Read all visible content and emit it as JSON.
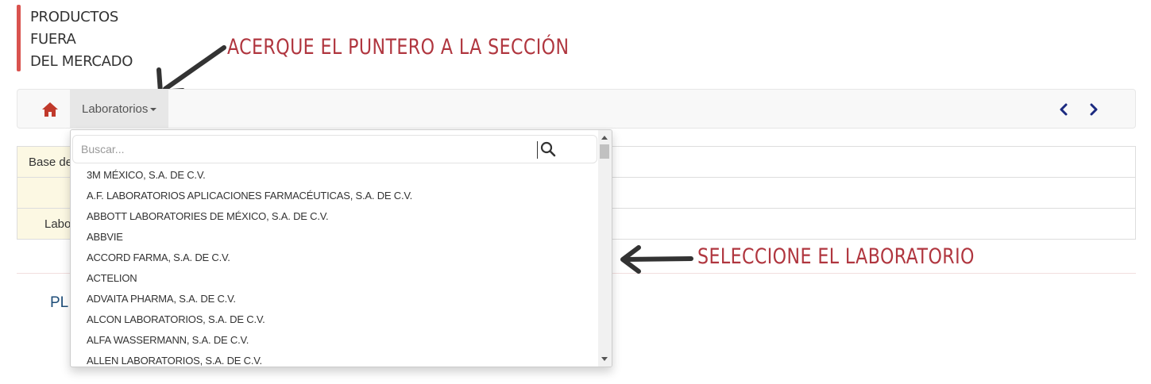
{
  "header": {
    "title_lines": [
      "PRODUCTOS",
      "FUERA",
      "DEL MERCADO"
    ]
  },
  "annotations": {
    "hover_hint": "ACERQUE EL PUNTERO A LA SECCIÓN",
    "select_hint": "SELECCIONE EL LABORATORIO"
  },
  "navbar": {
    "home_icon": "home-icon",
    "menu_label": "Laboratorios",
    "prev_icon": "chevron-left-icon",
    "next_icon": "chevron-right-icon",
    "nav_color": "#1b2a80"
  },
  "dropdown": {
    "search_placeholder": "Buscar...",
    "search_icon": "search-icon",
    "items": [
      "3M MÉXICO, S.A. DE C.V.",
      "A.F. LABORATORIOS APLICACIONES FARMACÉUTICAS, S.A. DE C.V.",
      "ABBOTT LABORATORIES DE MÉXICO, S.A. DE C.V.",
      "ABBVIE",
      "ACCORD FARMA, S.A. DE C.V.",
      "ACTELION",
      "ADVAITA PHARMA, S.A. DE C.V.",
      "ALCON LABORATORIOS, S.A. DE C.V.",
      "ALFA WASSERMANN, S.A. DE C.V.",
      "ALLEN LABORATORIOS, S.A. DE C.V."
    ]
  },
  "table": {
    "row1_label": "Base de",
    "row3_label": "Labo"
  },
  "footer": {
    "partial_text": "PL"
  },
  "colors": {
    "accent": "#d9534f",
    "annotation": "#b0363f",
    "home": "#c0392b"
  }
}
